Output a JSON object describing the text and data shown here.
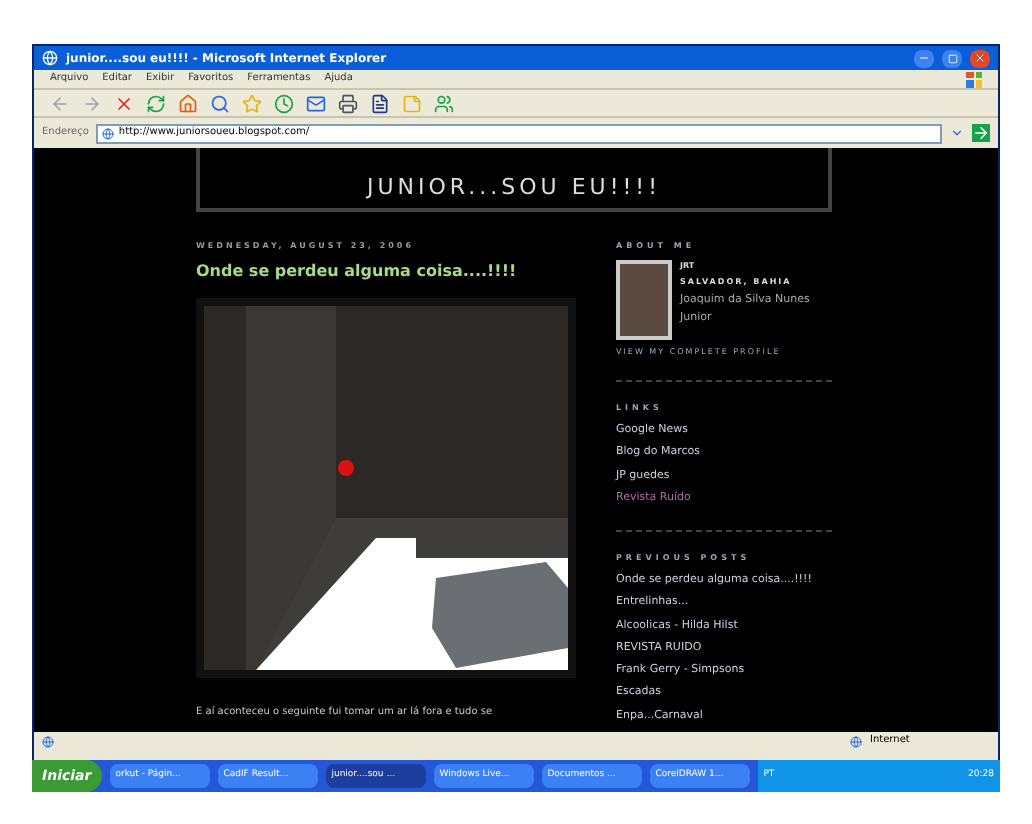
{
  "window": {
    "title": "junior....sou eu!!!! - Microsoft Internet Explorer"
  },
  "menu": [
    "Arquivo",
    "Editar",
    "Exibir",
    "Favoritos",
    "Ferramentas",
    "Ajuda"
  ],
  "address": {
    "label": "Endereço",
    "value": "http://www.juniorsoueu.blogspot.com/"
  },
  "blog": {
    "header": "JUNIOR...SOU EU!!!!",
    "date": "WEDNESDAY, AUGUST 23, 2006",
    "post_title": "Onde se perdeu alguma coisa....!!!!",
    "body": "E aí aconteceu o seguinte fui tomar um ar lá fora e tudo se"
  },
  "sidebar": {
    "about_heading": "ABOUT ME",
    "name": "JRT",
    "location": "SALVADOR, BAHIA",
    "full_name": "Joaquim da Silva Nunes Junior",
    "profile_link": "VIEW MY COMPLETE PROFILE",
    "links_heading": "LINKS",
    "links": [
      {
        "label": "Google News",
        "visited": false
      },
      {
        "label": "Blog do Marcos",
        "visited": false
      },
      {
        "label": "JP guedes",
        "visited": false
      },
      {
        "label": "Revista Ruído",
        "visited": true
      }
    ],
    "posts_heading": "PREVIOUS POSTS",
    "posts": [
      "Onde se perdeu alguma coisa....!!!!",
      "Entrelinhas...",
      "Alcoolicas - Hilda Hilst",
      "REVISTA RUIDO",
      "Frank Gerry - Simpsons",
      "Escadas",
      "Enpa...Carnaval"
    ]
  },
  "status_bar": {
    "zone": "Internet"
  },
  "taskbar": {
    "start": "Iniciar",
    "tasks": [
      {
        "label": "orkut - Págin...",
        "selected": false
      },
      {
        "label": "CadIF Result...",
        "selected": false
      },
      {
        "label": "junior....sou ...",
        "selected": true
      },
      {
        "label": "Windows Live...",
        "selected": false
      },
      {
        "label": "Documentos ...",
        "selected": false
      },
      {
        "label": "CorelDRAW 1...",
        "selected": false
      }
    ],
    "language": "PT",
    "clock": "20:28"
  }
}
